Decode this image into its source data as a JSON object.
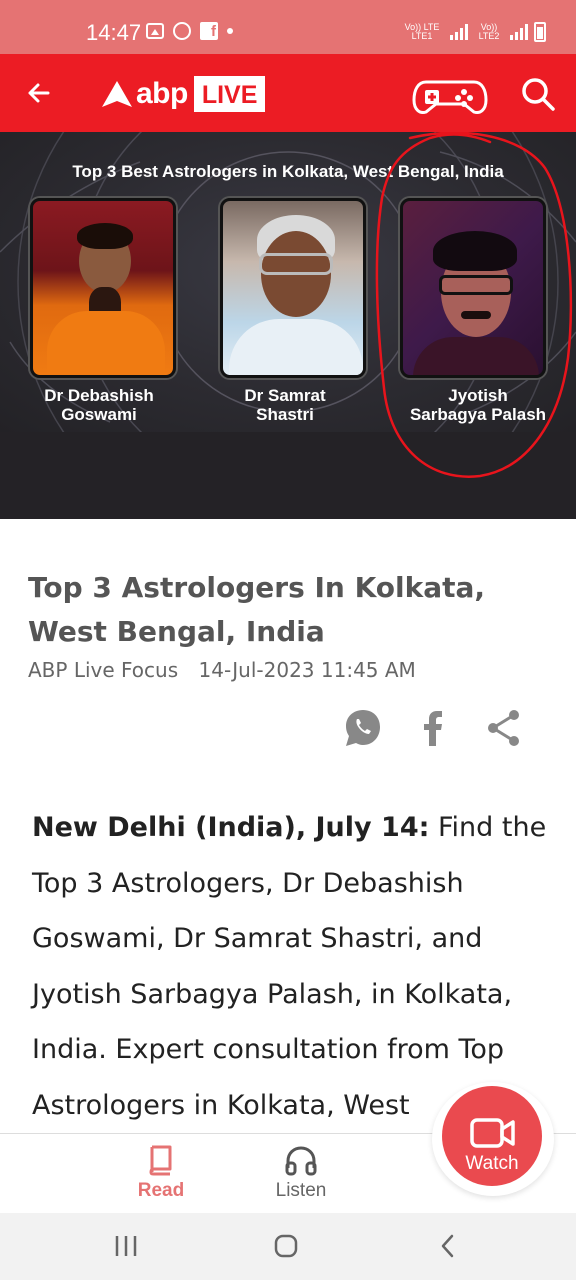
{
  "status_bar": {
    "time": "14:47",
    "network": [
      "Vo)) LTE LTE1",
      "Vo)) LTE2"
    ]
  },
  "header": {
    "logo_text": "abp",
    "logo_badge": "LIVE",
    "icons": [
      "back-arrow-icon",
      "gamepad-icon",
      "search-icon"
    ]
  },
  "hero": {
    "title": "Top 3 Best Astrologers in Kolkata, West Bengal, India",
    "people": [
      {
        "line1": "Dr Debashish",
        "line2": "Goswami"
      },
      {
        "line1": "Dr Samrat",
        "line2": "Shastri"
      },
      {
        "line1": "Jyotish",
        "line2": "Sarbagya Palash"
      }
    ],
    "annotation_color": "#e8141c"
  },
  "article": {
    "title": "Top 3 Astrologers In Kolkata, West Bengal, India",
    "author": "ABP Live Focus",
    "date": "14-Jul-2023 11:45 AM",
    "share_icons": [
      "whatsapp-icon",
      "facebook-icon",
      "share-icon"
    ],
    "lead": "New Delhi (India), July 14:",
    "body": " Find the Top 3 Astrologers, Dr Debashish Goswami, Dr Samrat Shastri, and Jyotish Sarbagya Palash, in Kolkata, India. Expert consultation from Top Astrologers in Kolkata, West"
  },
  "bottom_nav": {
    "read": "Read",
    "listen": "Listen",
    "watch": "Watch"
  },
  "colors": {
    "brand_red": "#ec1c24",
    "status_bar": "#e57373",
    "watch_button": "#ea4a4f"
  }
}
